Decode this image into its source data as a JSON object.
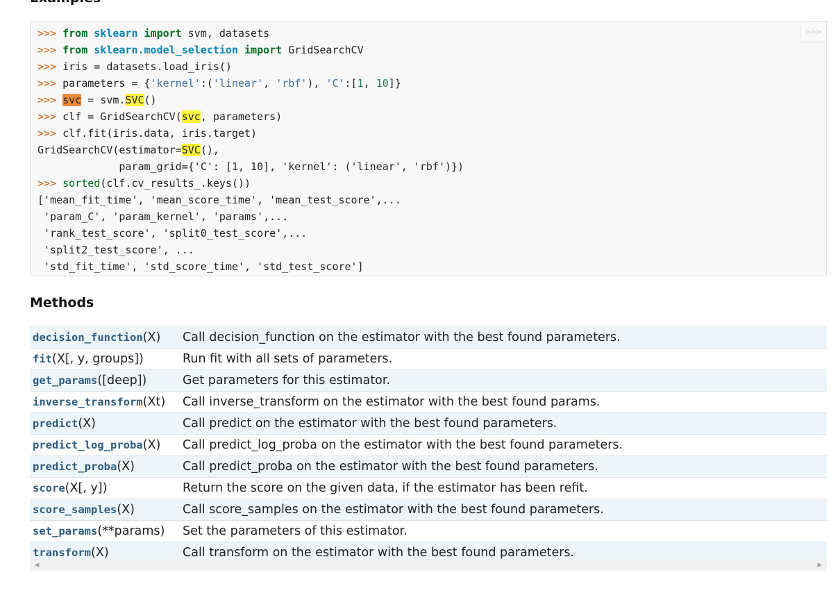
{
  "section_heading": "Examples",
  "code": {
    "copy_label": ">>>",
    "lines": [
      [
        {
          "t": ">>> ",
          "c": "tk-prompt"
        },
        {
          "t": "from",
          "c": "tk-kw"
        },
        {
          "t": " "
        },
        {
          "t": "sklearn",
          "c": "tk-mod"
        },
        {
          "t": " "
        },
        {
          "t": "import",
          "c": "tk-kw"
        },
        {
          "t": " svm, datasets"
        }
      ],
      [
        {
          "t": ">>> ",
          "c": "tk-prompt"
        },
        {
          "t": "from",
          "c": "tk-kw"
        },
        {
          "t": " "
        },
        {
          "t": "sklearn.model_selection",
          "c": "tk-mod"
        },
        {
          "t": " "
        },
        {
          "t": "import",
          "c": "tk-kw"
        },
        {
          "t": " GridSearchCV"
        }
      ],
      [
        {
          "t": ">>> ",
          "c": "tk-prompt"
        },
        {
          "t": "iris = datasets.load_iris()"
        }
      ],
      [
        {
          "t": ">>> ",
          "c": "tk-prompt"
        },
        {
          "t": "parameters = {"
        },
        {
          "t": "'kernel'",
          "c": "tk-str"
        },
        {
          "t": ":("
        },
        {
          "t": "'linear'",
          "c": "tk-str"
        },
        {
          "t": ", "
        },
        {
          "t": "'rbf'",
          "c": "tk-str"
        },
        {
          "t": "), "
        },
        {
          "t": "'C'",
          "c": "tk-str"
        },
        {
          "t": ":["
        },
        {
          "t": "1",
          "c": "tk-num"
        },
        {
          "t": ", "
        },
        {
          "t": "10",
          "c": "tk-num"
        },
        {
          "t": "]}"
        }
      ],
      [
        {
          "t": ">>> ",
          "c": "tk-prompt"
        },
        {
          "t": "svc",
          "c": "hl-orange"
        },
        {
          "t": " = svm."
        },
        {
          "t": "SVC",
          "c": "hl-yellow"
        },
        {
          "t": "()"
        }
      ],
      [
        {
          "t": ">>> ",
          "c": "tk-prompt"
        },
        {
          "t": "clf = GridSearchCV("
        },
        {
          "t": "svc",
          "c": "hl-yellow"
        },
        {
          "t": ", parameters)"
        }
      ],
      [
        {
          "t": ">>> ",
          "c": "tk-prompt"
        },
        {
          "t": "clf.fit(iris.data, iris.target)"
        }
      ],
      [
        {
          "t": "GridSearchCV(estimator="
        },
        {
          "t": "SVC",
          "c": "hl-yellow"
        },
        {
          "t": "(),"
        }
      ],
      [
        {
          "t": "             param_grid={'C': [1, 10], 'kernel': ('linear', 'rbf')})"
        }
      ],
      [
        {
          "t": ">>> ",
          "c": "tk-prompt"
        },
        {
          "t": "sorted",
          "c": "tk-builtin"
        },
        {
          "t": "(clf.cv_results_.keys())"
        }
      ],
      [
        {
          "t": "['mean_fit_time', 'mean_score_time', 'mean_test_score',..."
        }
      ],
      [
        {
          "t": " 'param_C', 'param_kernel', 'params',..."
        }
      ],
      [
        {
          "t": " 'rank_test_score', 'split0_test_score',..."
        }
      ],
      [
        {
          "t": " 'split2_test_score', ..."
        }
      ],
      [
        {
          "t": " 'std_fit_time', 'std_score_time', 'std_test_score']"
        }
      ]
    ]
  },
  "methods": {
    "title": "Methods",
    "rows": [
      {
        "name": "decision_function",
        "args": "(X)",
        "desc": "Call decision_function on the estimator with the best found parameters."
      },
      {
        "name": "fit",
        "args": "(X[, y, groups])",
        "desc": "Run fit with all sets of parameters."
      },
      {
        "name": "get_params",
        "args": "([deep])",
        "desc": "Get parameters for this estimator."
      },
      {
        "name": "inverse_transform",
        "args": "(Xt)",
        "desc": "Call inverse_transform on the estimator with the best found params."
      },
      {
        "name": "predict",
        "args": "(X)",
        "desc": "Call predict on the estimator with the best found parameters."
      },
      {
        "name": "predict_log_proba",
        "args": "(X)",
        "desc": "Call predict_log_proba on the estimator with the best found parameters."
      },
      {
        "name": "predict_proba",
        "args": "(X)",
        "desc": "Call predict_proba on the estimator with the best found parameters."
      },
      {
        "name": "score",
        "args": "(X[, y])",
        "desc": "Return the score on the given data, if the estimator has been refit."
      },
      {
        "name": "score_samples",
        "args": "(X)",
        "desc": "Call score_samples on the estimator with the best found parameters."
      },
      {
        "name": "set_params",
        "args": "(**params)",
        "desc": "Set the parameters of this estimator."
      },
      {
        "name": "transform",
        "args": "(X)",
        "desc": "Call transform on the estimator with the best found parameters."
      }
    ]
  },
  "scrollbar": {
    "left_icon": "◀",
    "right_icon": "▶"
  }
}
